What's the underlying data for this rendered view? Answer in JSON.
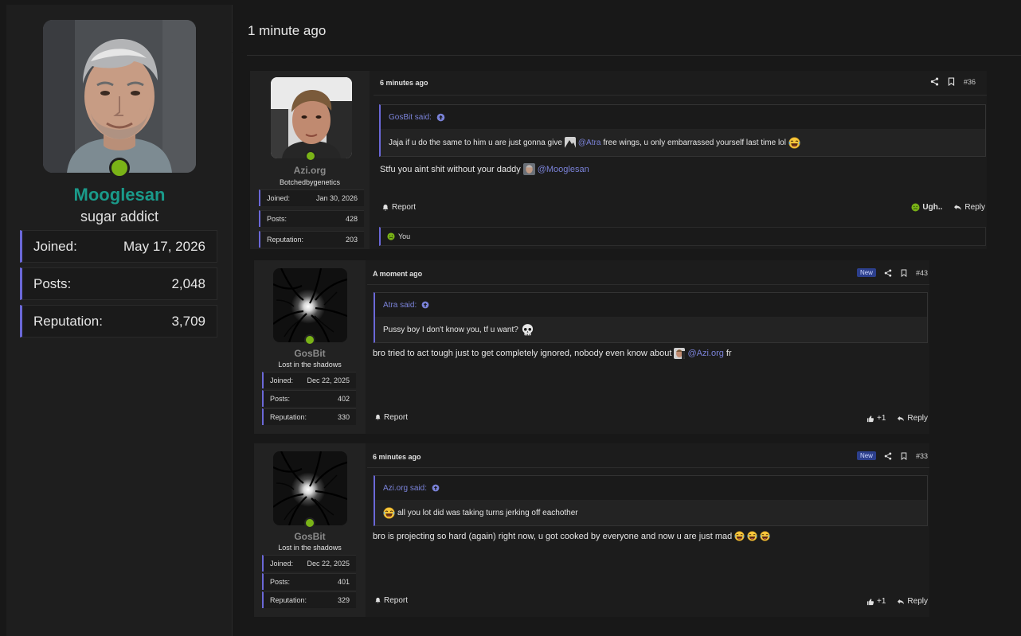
{
  "profile": {
    "name": "Mooglesan",
    "title": "sugar addict",
    "stats": [
      {
        "label": "Joined:",
        "value": "May 17, 2026"
      },
      {
        "label": "Posts:",
        "value": "2,048"
      },
      {
        "label": "Reputation:",
        "value": "3,709"
      }
    ]
  },
  "header": {
    "time": "1 minute ago"
  },
  "colors": {
    "accent": "#6b68d8",
    "online": "#7ab317",
    "username": "#1a9a8a",
    "mention": "#7a82d8"
  },
  "posts": [
    {
      "user": {
        "name": "Azi.org",
        "title": "Botchedbygenetics",
        "stats": [
          {
            "label": "Joined:",
            "value": "Jan 30, 2026"
          },
          {
            "label": "Posts:",
            "value": "428"
          },
          {
            "label": "Reputation:",
            "value": "203"
          }
        ]
      },
      "time": "6 minutes ago",
      "number": "#36",
      "quote": {
        "author": "GosBit said:",
        "pre": "Jaja if u do the same to him u are just gonna give",
        "mention": "@Atra",
        "post": "free wings, u only embarrassed yourself last time lol"
      },
      "body": {
        "pre": "Stfu you aint shit without your daddy",
        "mention": "@Mooglesan",
        "post": ""
      },
      "report": "Report",
      "reaction_label": "Ugh..",
      "reply": "Reply",
      "reacted_by": "You"
    },
    {
      "user": {
        "name": "GosBit",
        "title": "Lost in the shadows",
        "stats": [
          {
            "label": "Joined:",
            "value": "Dec 22, 2025"
          },
          {
            "label": "Posts:",
            "value": "402"
          },
          {
            "label": "Reputation:",
            "value": "330"
          }
        ]
      },
      "time": "A moment ago",
      "badge": "New",
      "number": "#43",
      "quote": {
        "author": "Atra said:",
        "text": "Pussy boy I don't know you, tf u want?"
      },
      "body": {
        "pre": "bro tried to act tough just to get completely ignored, nobody even know about",
        "mention": "@Azi.org",
        "post": "fr"
      },
      "report": "Report",
      "like": "+1",
      "reply": "Reply"
    },
    {
      "user": {
        "name": "GosBit",
        "title": "Lost in the shadows",
        "stats": [
          {
            "label": "Joined:",
            "value": "Dec 22, 2025"
          },
          {
            "label": "Posts:",
            "value": "401"
          },
          {
            "label": "Reputation:",
            "value": "329"
          }
        ]
      },
      "time": "6 minutes ago",
      "badge": "New",
      "number": "#33",
      "quote": {
        "author": "Azi.org said:",
        "text": "all you lot did was taking turns jerking off eachother"
      },
      "body": {
        "pre": "bro is projecting so hard (again) right now, u got cooked by everyone and now u are just mad",
        "mention": "",
        "post": ""
      },
      "report": "Report",
      "like": "+1",
      "reply": "Reply"
    }
  ]
}
